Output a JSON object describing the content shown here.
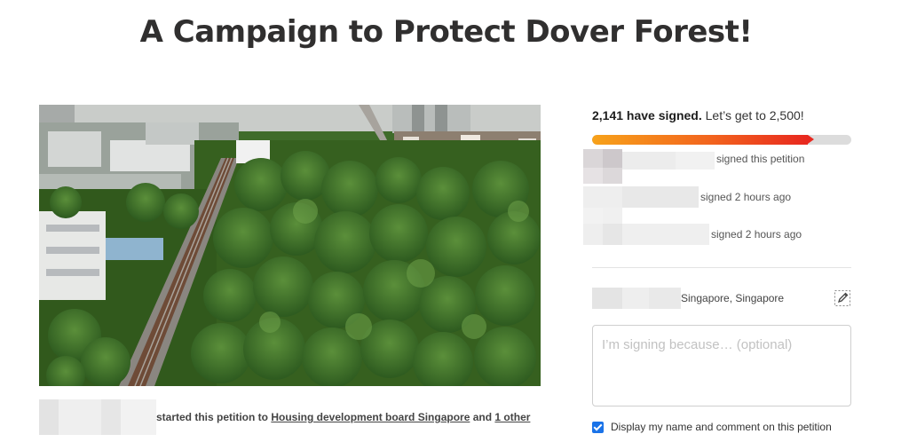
{
  "title": "A Campaign to Protect Dover Forest!",
  "petition": {
    "signed_count": "2,141 have signed.",
    "goal_text": "Let’s get to 2,500!",
    "progress_fraction": 0.856
  },
  "recent_signers": [
    {
      "status": "signed this petition"
    },
    {
      "status": "signed 2 hours ago"
    },
    {
      "status": "signed 2 hours ago"
    }
  ],
  "location": "Singapore, Singapore",
  "comment": {
    "placeholder": "I’m signing because… (optional)",
    "value": ""
  },
  "display_option": {
    "label": "Display my name and comment on this petition",
    "checked": true
  },
  "starter": {
    "text": "started this petition to",
    "target": "Housing development board Singapore",
    "and": "and",
    "other": "1 other"
  },
  "colors": {
    "progress_start": "#f7a21a",
    "progress_end": "#e8281f",
    "checkbox": "#1a73e8"
  }
}
